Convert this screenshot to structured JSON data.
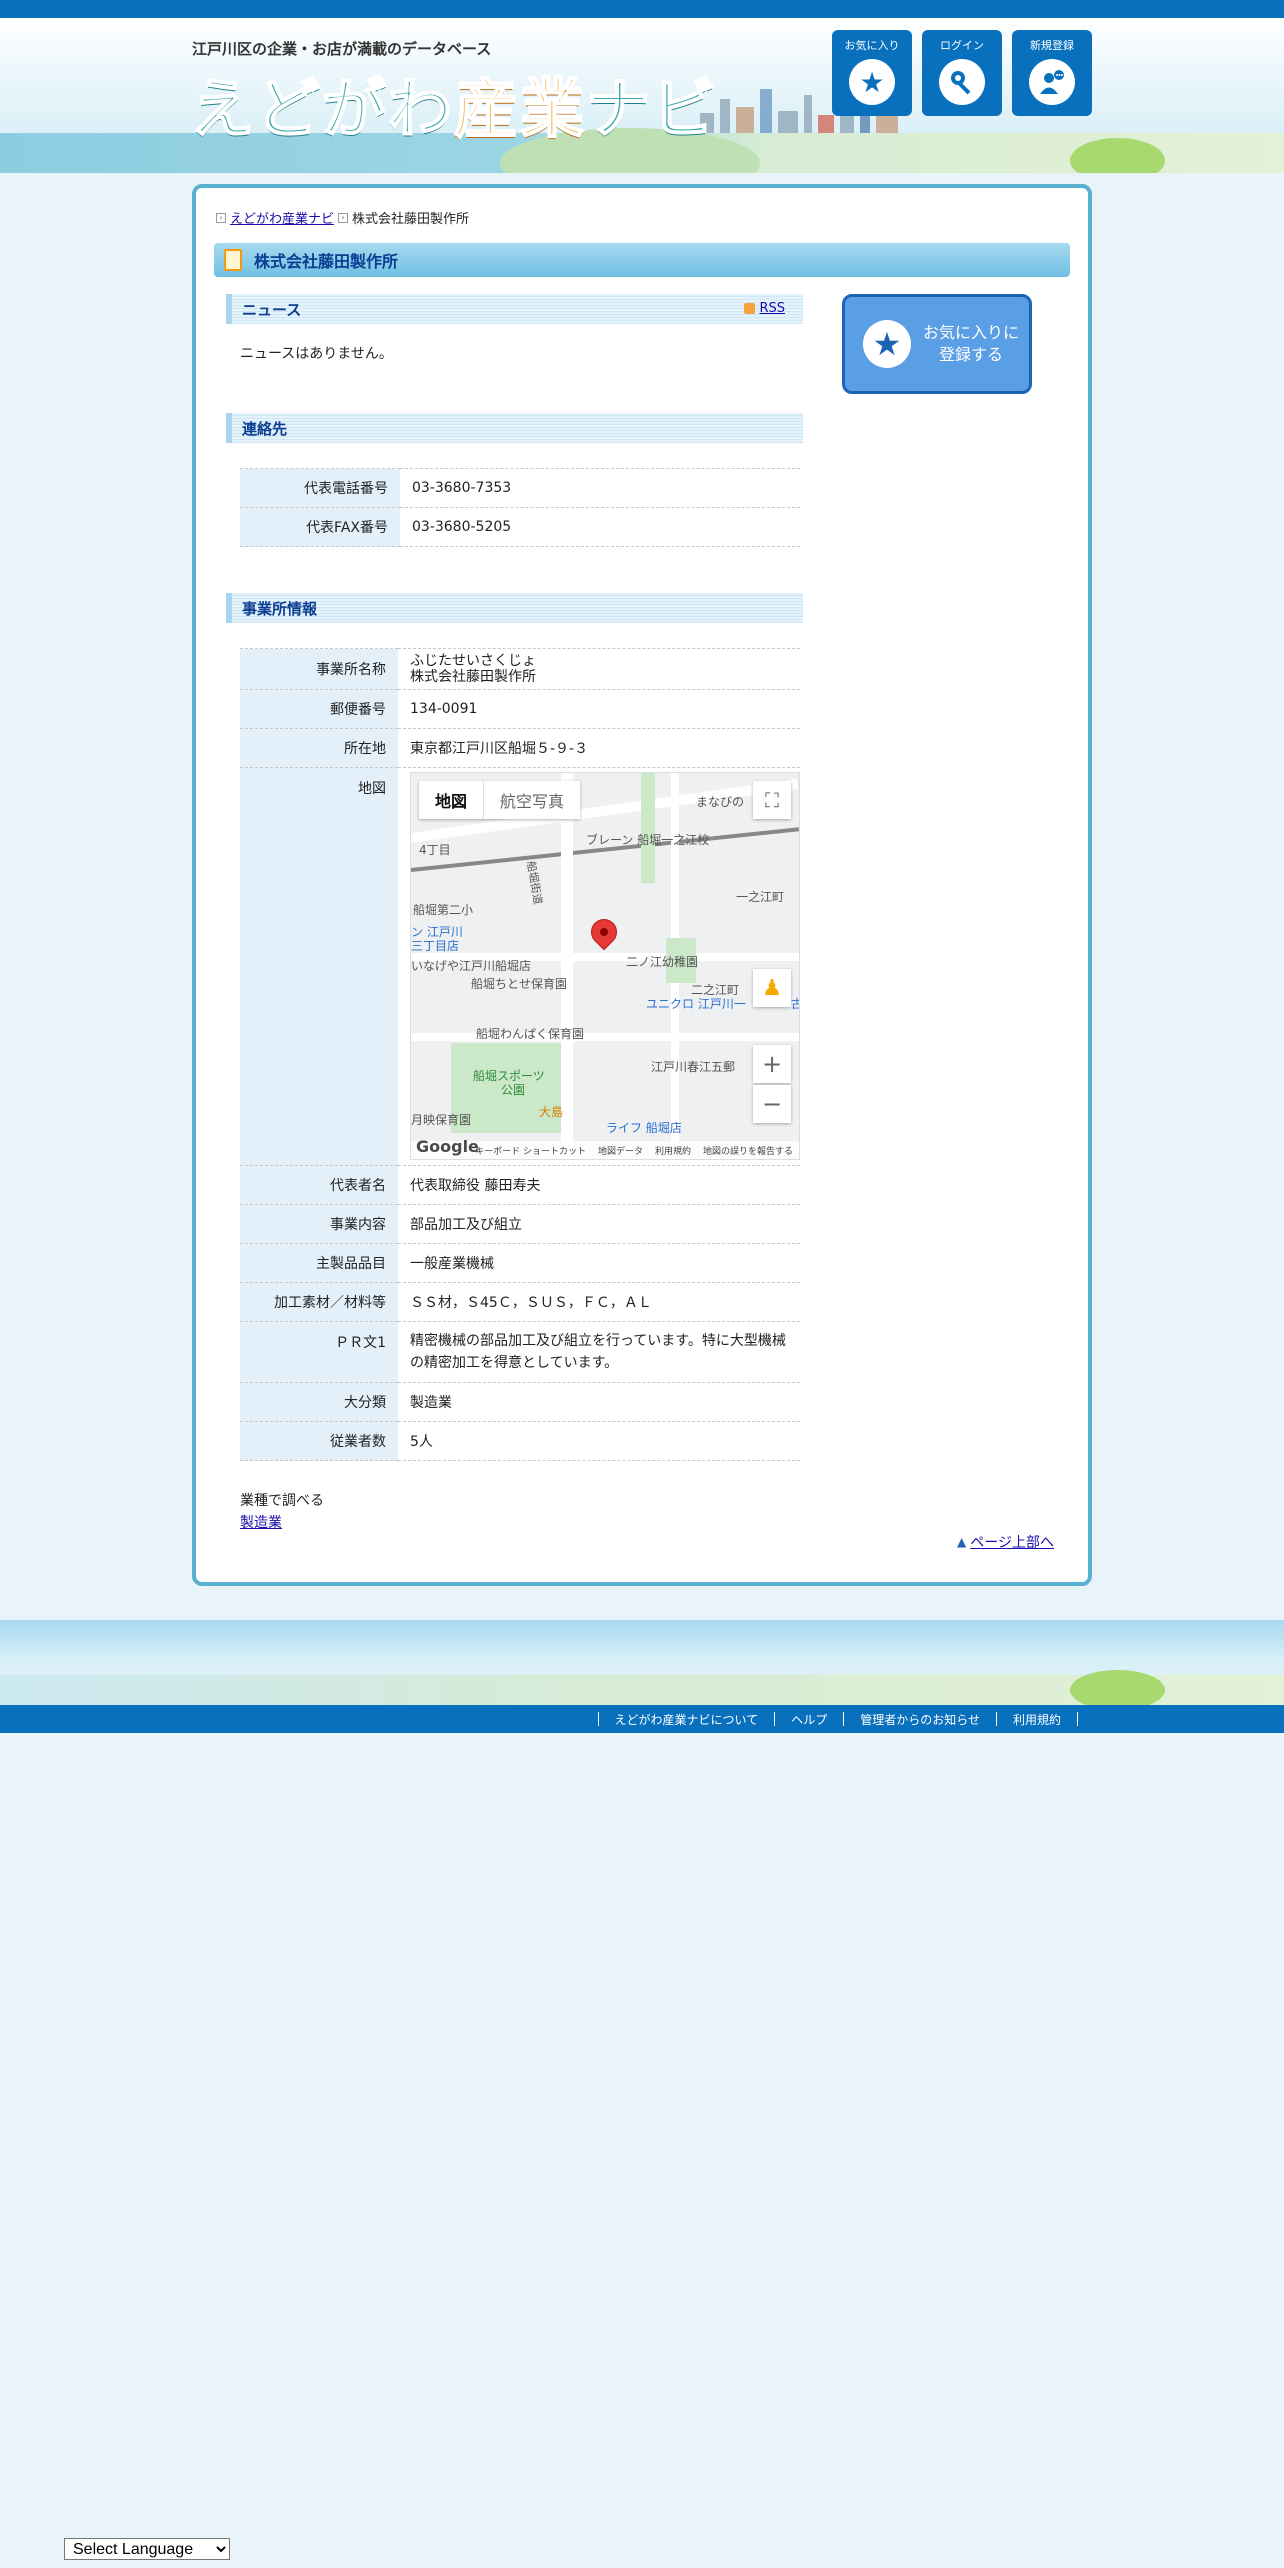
{
  "header": {
    "tagline": "江戸川区の企業・お店が満載のデータベース",
    "logo_part1": "えどがわ",
    "logo_part2": "産業",
    "logo_part3": "ナビ",
    "buttons": [
      {
        "label": "お気に入り",
        "icon": "star-icon"
      },
      {
        "label": "ログイン",
        "icon": "key-icon"
      },
      {
        "label": "新規登録",
        "icon": "user-add-icon"
      }
    ]
  },
  "breadcrumb": {
    "home": "えどがわ産業ナビ",
    "current": "株式会社藤田製作所"
  },
  "page_title": "株式会社藤田製作所",
  "news": {
    "heading": "ニュース",
    "rss_label": "RSS",
    "empty_text": "ニュースはありません。"
  },
  "favorite_button": {
    "line1": "お気に入りに",
    "line2": "登録する",
    "icon": "star-icon"
  },
  "contact": {
    "heading": "連絡先",
    "rows": [
      {
        "key": "代表電話番号",
        "value": "03-3680-7353"
      },
      {
        "key": "代表FAX番号",
        "value": "03-3680-5205"
      }
    ]
  },
  "office": {
    "heading": "事業所情報",
    "name_key": "事業所名称",
    "name_kana": "ふじたせいさくじょ",
    "name_value": "株式会社藤田製作所",
    "postal_key": "郵便番号",
    "postal_value": "134-0091",
    "address_key": "所在地",
    "address_value": "東京都江戸川区船堀５-９-３",
    "map_key": "地図",
    "rows": [
      {
        "key": "代表者名",
        "value": "代表取締役 藤田寿夫"
      },
      {
        "key": "事業内容",
        "value": "部品加工及び組立"
      },
      {
        "key": "主製品品目",
        "value": "一般産業機械"
      },
      {
        "key": "加工素材／材料等",
        "value": "ＳＳ材，Ｓ45Ｃ，ＳＵＳ，ＦＣ，ＡＬ"
      },
      {
        "key": "ＰＲ文1",
        "value": "精密機械の部品加工及び組立を行っています。特に大型機械の精密加工を得意としています。"
      },
      {
        "key": "大分類",
        "value": "製造業"
      },
      {
        "key": "従業者数",
        "value": "5人"
      }
    ]
  },
  "map": {
    "tab_map": "地図",
    "tab_satellite": "航空写真",
    "labels": {
      "l1": "まなびの",
      "l2": "ブレーン 船堀一之江校",
      "l3": "4丁目",
      "l4": "一之江町",
      "l5": "船堀第二小",
      "l6": "ン 江戸川",
      "l7": "三丁目店",
      "l8": "いなげや江戸川船堀店",
      "l9": "二ノ江幼稚園",
      "l10": "船堀ちとせ保育園",
      "l11": "二之江町",
      "l12": "ユニクロ 江戸川一",
      "l13": "船堀わんぱく保育園",
      "l14": "江戸川春江五郵",
      "l15": "船堀スポーツ",
      "l16": "公園",
      "l17": "大島",
      "l18": "月映保育園",
      "l19": "ライフ 船堀店",
      "l20": "船堀街道",
      "l21": "古"
    },
    "footer": [
      "キーボード ショートカット",
      "地図データ",
      "利用規約",
      "地図の誤りを報告する"
    ],
    "google_logo": "Google"
  },
  "gyousyu": {
    "label": "業種で調べる",
    "link": "製造業"
  },
  "pagetop": "ページ上部へ",
  "footer_links": [
    "えどがわ産業ナビについて",
    "ヘルプ",
    "管理者からのお知らせ",
    "利用規約"
  ],
  "language_select": "Select Language",
  "colors": {
    "brand_blue": "#0870bd",
    "frame": "#58b1d1",
    "logo_teal": "#3aa8a8",
    "logo_orange": "#f29a12"
  }
}
